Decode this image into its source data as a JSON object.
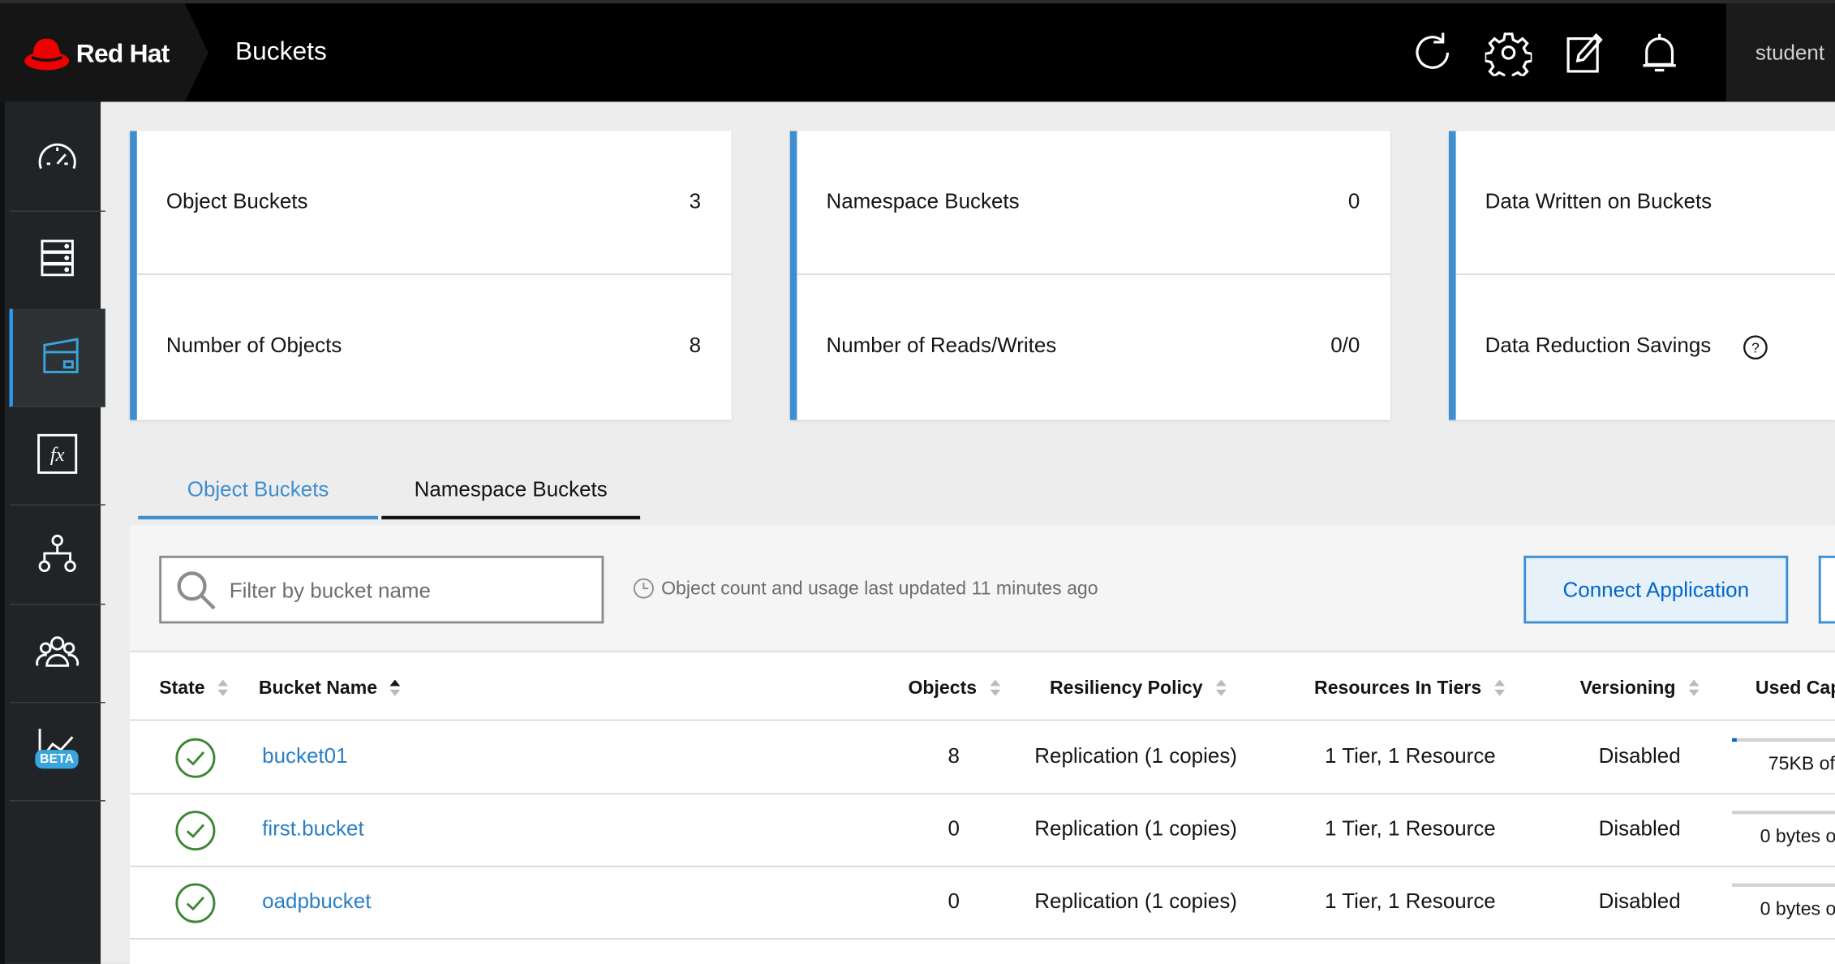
{
  "header": {
    "brand": "Red Hat",
    "title": "Buckets",
    "user": "student",
    "icons": [
      "refresh-icon",
      "gear-icon",
      "edit-icon",
      "bell-icon"
    ]
  },
  "sidebar": {
    "items": [
      {
        "name": "dashboard",
        "icon": "speedometer-icon"
      },
      {
        "name": "resources",
        "icon": "server-icon"
      },
      {
        "name": "buckets",
        "icon": "bucket-icon",
        "active": true
      },
      {
        "name": "functions",
        "icon": "fx-icon"
      },
      {
        "name": "topology",
        "icon": "hierarchy-icon"
      },
      {
        "name": "accounts",
        "icon": "users-icon"
      },
      {
        "name": "analytics",
        "icon": "chart-icon",
        "badge": "BETA"
      }
    ]
  },
  "cards": [
    {
      "rows": [
        {
          "label": "Object Buckets",
          "value": "3"
        },
        {
          "label": "Number of Objects",
          "value": "8"
        }
      ]
    },
    {
      "rows": [
        {
          "label": "Namespace Buckets",
          "value": "0"
        },
        {
          "label": "Number of Reads/Writes",
          "value": "0/0"
        }
      ]
    },
    {
      "rows": [
        {
          "label": "Data Written on Buckets",
          "value": ""
        },
        {
          "label": "Data Reduction Savings",
          "value": ""
        }
      ]
    }
  ],
  "tabs": [
    {
      "label": "Object Buckets",
      "active": true
    },
    {
      "label": "Namespace Buckets",
      "active": false
    }
  ],
  "toolbar": {
    "search_placeholder": "Filter by bucket name",
    "updated_text": "Object count and usage last updated 11 minutes ago",
    "connect_label": "Connect Application"
  },
  "table": {
    "columns": [
      "State",
      "Bucket Name",
      "Objects",
      "Resiliency Policy",
      "Resources In Tiers",
      "Versioning",
      "Used Cap"
    ],
    "rows": [
      {
        "state": "healthy",
        "name": "bucket01",
        "objects": "8",
        "policy": "Replication (1 copies)",
        "tiers": "1 Tier, 1 Resource",
        "versioning": "Disabled",
        "used": "75KB of",
        "used_fraction": 0.04
      },
      {
        "state": "healthy",
        "name": "first.bucket",
        "objects": "0",
        "policy": "Replication (1 copies)",
        "tiers": "1 Tier, 1 Resource",
        "versioning": "Disabled",
        "used": "0 bytes o",
        "used_fraction": 0
      },
      {
        "state": "healthy",
        "name": "oadpbucket",
        "objects": "0",
        "policy": "Replication (1 copies)",
        "tiers": "1 Tier, 1 Resource",
        "versioning": "Disabled",
        "used": "0 bytes o",
        "used_fraction": 0
      }
    ]
  },
  "colors": {
    "accent": "#3e8ed0",
    "link": "#2b7fc4",
    "success": "#3e8635",
    "brand_red": "#ee0000"
  }
}
